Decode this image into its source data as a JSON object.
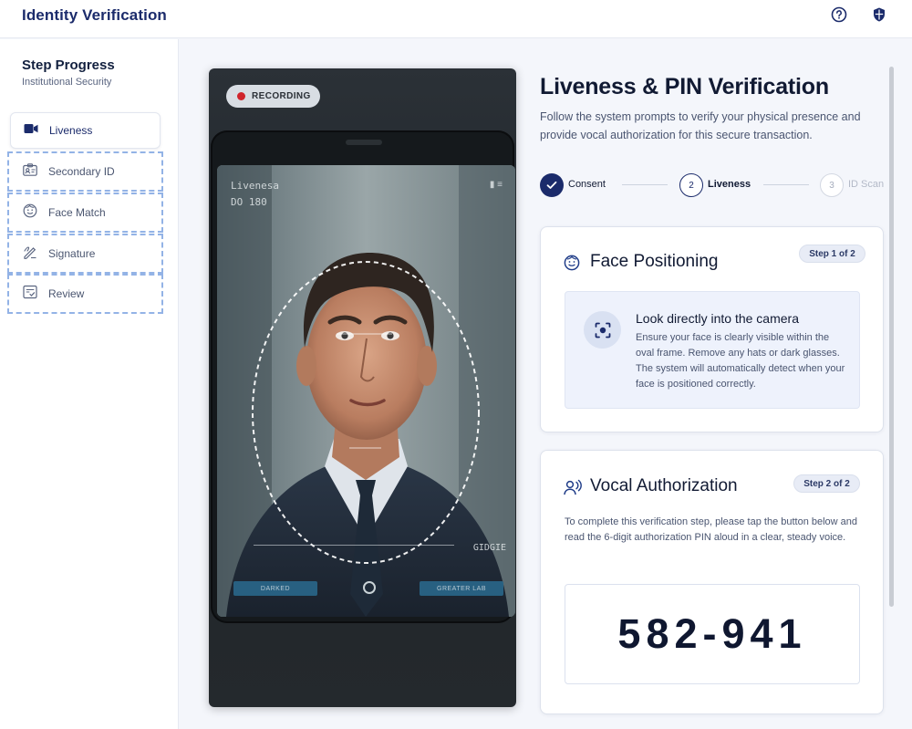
{
  "header": {
    "title": "Identity Verification",
    "help_icon": "help-circle-icon",
    "shield_icon": "shield-icon"
  },
  "sidebar": {
    "title": "Step Progress",
    "subtitle": "Institutional Security",
    "items": [
      {
        "label": "Liveness",
        "icon": "video-camera-icon",
        "active": true
      },
      {
        "label": "Secondary ID",
        "icon": "id-card-icon",
        "active": false
      },
      {
        "label": "Face Match",
        "icon": "face-icon",
        "active": false
      },
      {
        "label": "Signature",
        "icon": "signature-icon",
        "active": false
      },
      {
        "label": "Review",
        "icon": "checklist-icon",
        "active": false
      }
    ]
  },
  "camera": {
    "recording_label": "RECORDING",
    "screen_label_line1": "Livenesa",
    "screen_label_line2": "DO 180",
    "screen_code": "GIDGIE",
    "screen_button_left": "DARKED",
    "screen_button_right": "GREATER LAB"
  },
  "main": {
    "title": "Liveness & PIN Verification",
    "description": "Follow the system prompts to verify your physical presence and provide vocal authorization for this secure transaction.",
    "steps": [
      {
        "number": "1",
        "label": "Consent",
        "state": "complete"
      },
      {
        "number": "2",
        "label": "Liveness",
        "state": "current"
      },
      {
        "number": "3",
        "label": "ID Scan",
        "state": "upcoming"
      }
    ]
  },
  "face_card": {
    "title": "Face Positioning",
    "badge": "Step 1 of 2",
    "info_title": "Look directly into the camera",
    "info_text": "Ensure your face is clearly visible within the oval frame. Remove any hats or dark glasses. The system will automatically detect when your face is positioned correctly."
  },
  "vocal_card": {
    "title": "Vocal Authorization",
    "badge": "Step 2 of 2",
    "text": "To complete this verification step, please tap the button below and read the 6-digit authorization PIN aloud in a clear, steady voice.",
    "pin": "582-941"
  },
  "colors": {
    "brand": "#1b2b6b",
    "accent": "#1f3c88",
    "recording": "#d0242b",
    "dashed_border": "#93b3e6"
  }
}
